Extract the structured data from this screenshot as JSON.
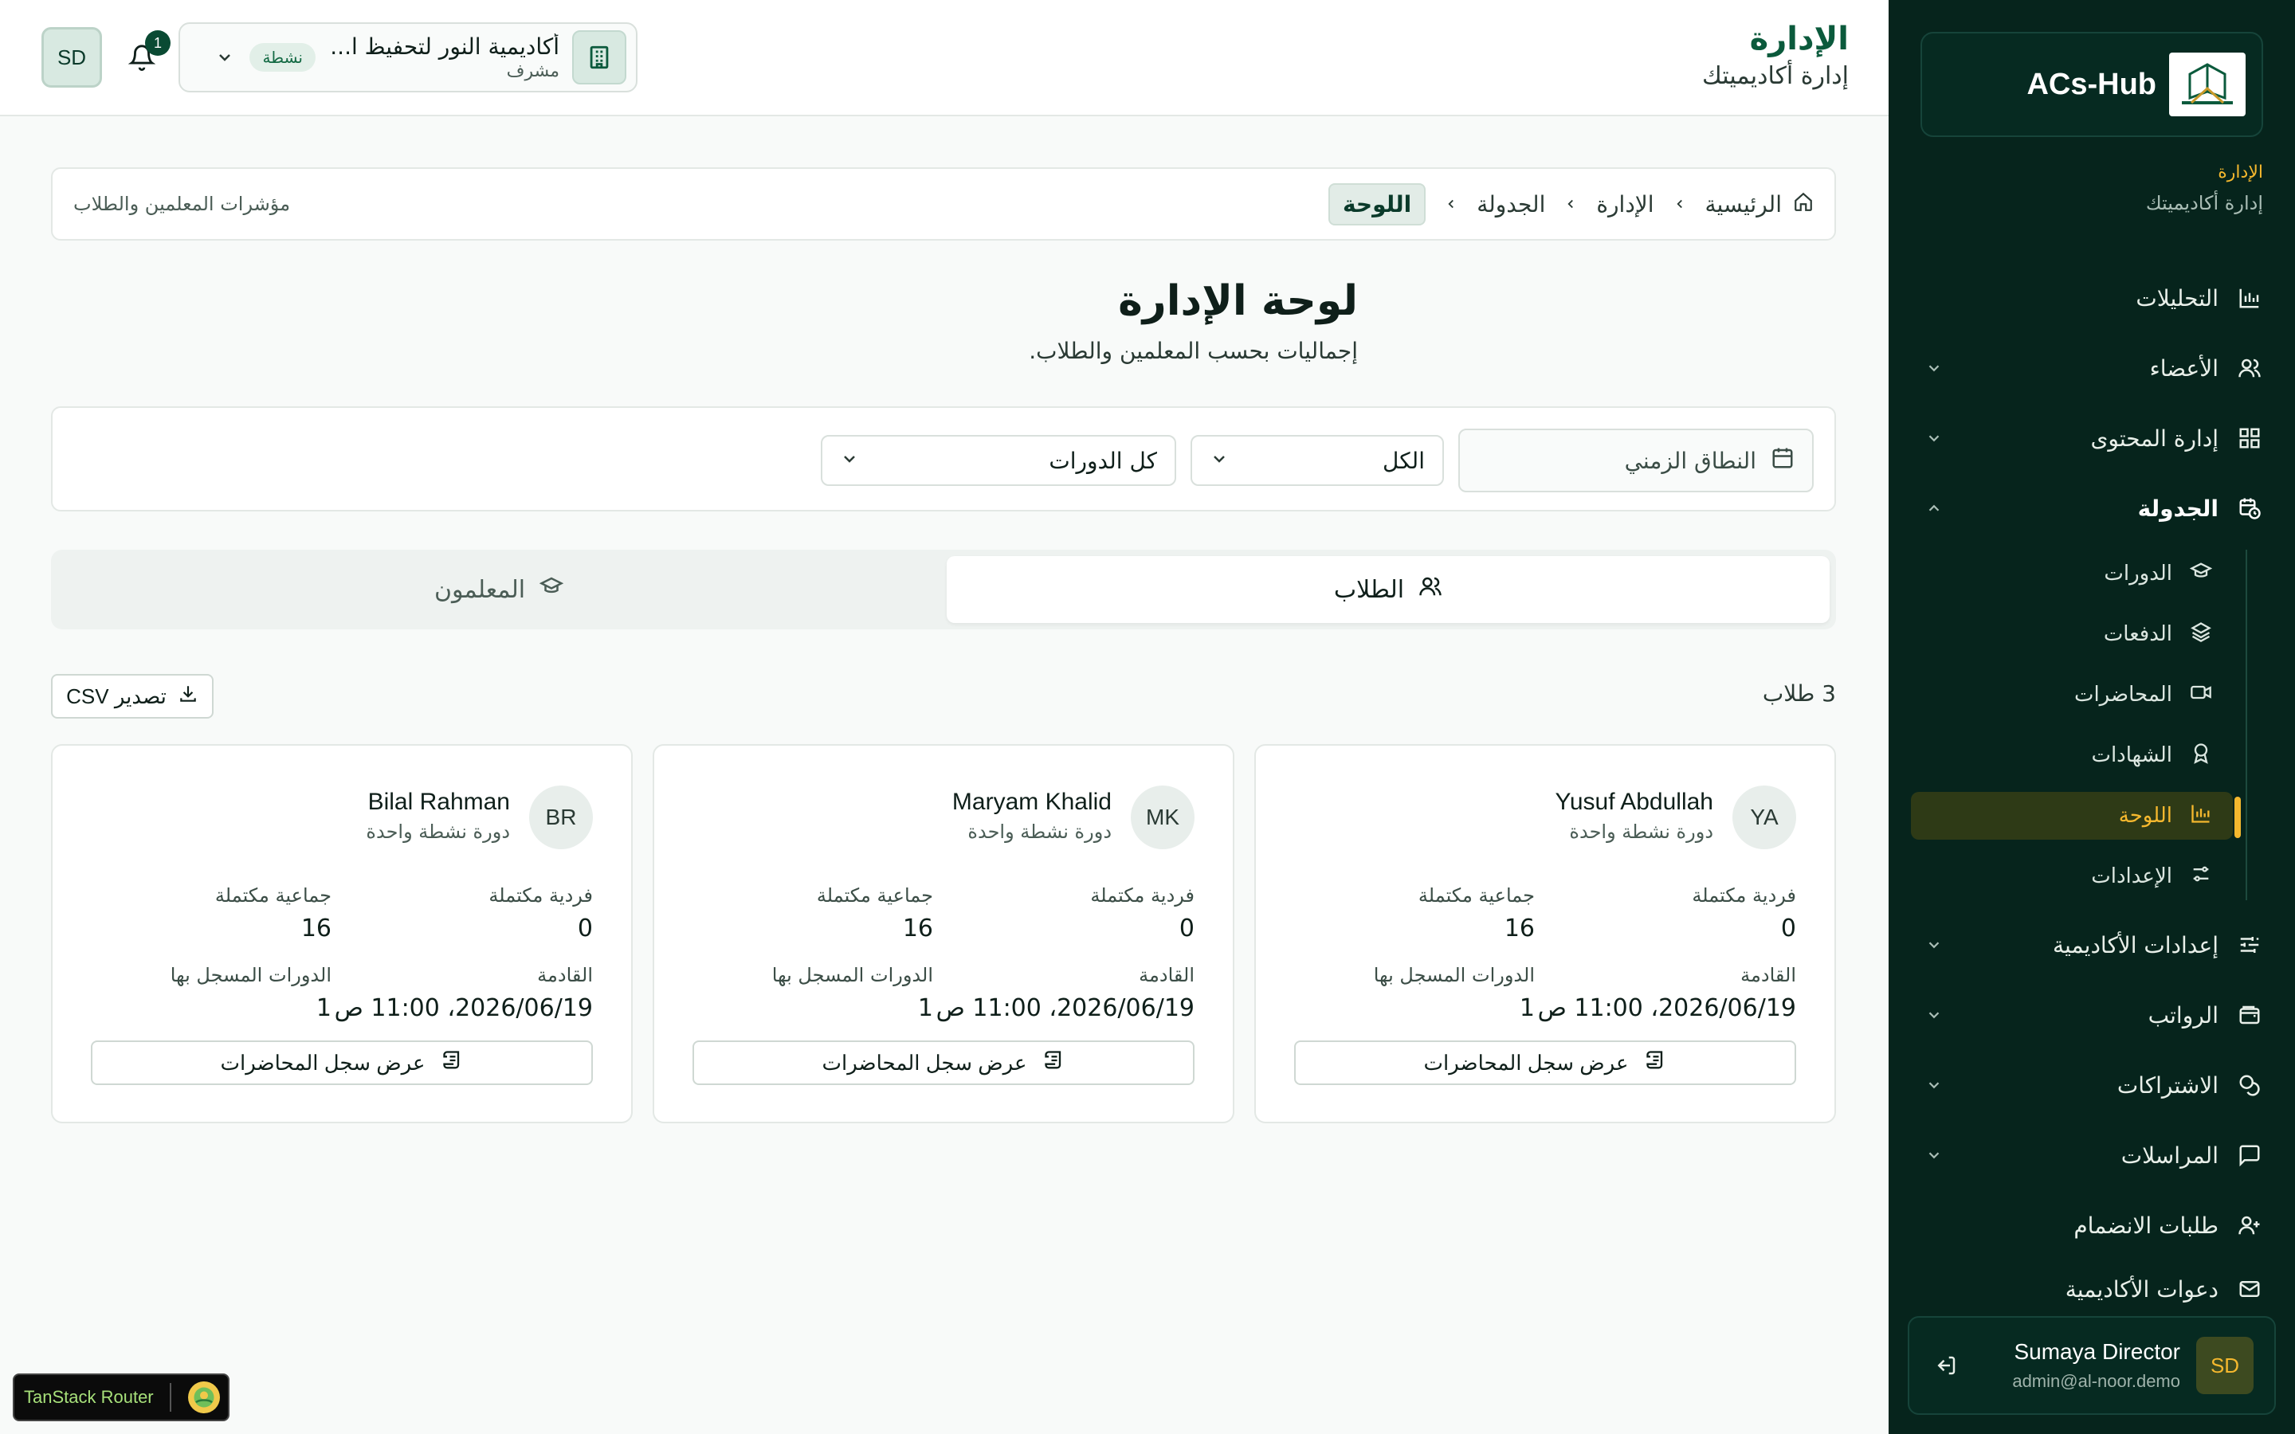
{
  "brand": {
    "name": "ACs-Hub"
  },
  "sidebar": {
    "section_title": "الإدارة",
    "section_subtitle": "إدارة أكاديميتك",
    "items": [
      {
        "label": "التحليلات",
        "icon": "bar-chart-icon"
      },
      {
        "label": "الأعضاء",
        "icon": "users-icon"
      },
      {
        "label": "إدارة المحتوى",
        "icon": "grid-icon"
      },
      {
        "label": "الجدولة",
        "icon": "calendar-clock-icon"
      },
      {
        "label": "إعدادات الأكاديمية",
        "icon": "sliders-icon"
      },
      {
        "label": "الرواتب",
        "icon": "wallet-icon"
      },
      {
        "label": "الاشتراكات",
        "icon": "coins-icon"
      },
      {
        "label": "المراسلات",
        "icon": "message-icon"
      },
      {
        "label": "طلبات الانضمام",
        "icon": "user-plus-icon"
      },
      {
        "label": "دعوات الأكاديمية",
        "icon": "mail-icon"
      }
    ],
    "sub_items": [
      {
        "label": "الدورات",
        "icon": "graduation-cap-icon"
      },
      {
        "label": "الدفعات",
        "icon": "layers-icon"
      },
      {
        "label": "المحاضرات",
        "icon": "video-icon"
      },
      {
        "label": "الشهادات",
        "icon": "award-icon"
      },
      {
        "label": "اللوحة",
        "icon": "bar-chart-icon"
      },
      {
        "label": "الإعدادات",
        "icon": "settings-sliders-icon"
      }
    ],
    "user": {
      "initials": "SD",
      "name": "Sumaya Director",
      "email": "admin@al-noor.demo"
    }
  },
  "header": {
    "title": "الإدارة",
    "subtitle": "إدارة أكاديميتك",
    "org": {
      "name": "أكاديمية النور لتحفيظ ا...",
      "role": "مشرف",
      "badge": "نشطة"
    },
    "notifications": "1",
    "user_initials": "SD"
  },
  "breadcrumb": {
    "items": [
      "الرئيسية",
      "الإدارة",
      "الجدولة",
      "اللوحة"
    ],
    "note": "مؤشرات المعلمين والطلاب"
  },
  "page": {
    "title": "لوحة الإدارة",
    "subtitle": "إجماليات بحسب المعلمين والطلاب."
  },
  "filters": {
    "date_range": "النطاق الزمني",
    "status": "الكل",
    "courses": "كل الدورات"
  },
  "tabs": {
    "students": "الطلاب",
    "teachers": "المعلمون"
  },
  "list": {
    "count": "3 طلاب",
    "export": "تصدير CSV"
  },
  "cards": [
    {
      "initials": "YA",
      "name": "Yusuf Abdullah",
      "sub": "دورة نشطة واحدة",
      "k1": "فردية مكتملة",
      "v1": "0",
      "k2": "جماعية مكتملة",
      "v2": "16",
      "k3": "القادمة",
      "v3": "2026/06/19، 11:00 ص",
      "k4": "الدورات المسجل بها",
      "v4": "1",
      "button": "عرض سجل المحاضرات"
    },
    {
      "initials": "MK",
      "name": "Maryam Khalid",
      "sub": "دورة نشطة واحدة",
      "k1": "فردية مكتملة",
      "v1": "0",
      "k2": "جماعية مكتملة",
      "v2": "16",
      "k3": "القادمة",
      "v3": "2026/06/19، 11:00 ص",
      "k4": "الدورات المسجل بها",
      "v4": "1",
      "button": "عرض سجل المحاضرات"
    },
    {
      "initials": "BR",
      "name": "Bilal Rahman",
      "sub": "دورة نشطة واحدة",
      "k1": "فردية مكتملة",
      "v1": "0",
      "k2": "جماعية مكتملة",
      "v2": "16",
      "k3": "القادمة",
      "v3": "2026/06/19، 11:00 ص",
      "k4": "الدورات المسجل بها",
      "v4": "1",
      "button": "عرض سجل المحاضرات"
    }
  ],
  "devtools": {
    "label": "TanStack Router"
  },
  "colors": {
    "sidebar_bg": "#06241c",
    "accent": "#f5b82e",
    "primary": "#0b5a3c"
  }
}
